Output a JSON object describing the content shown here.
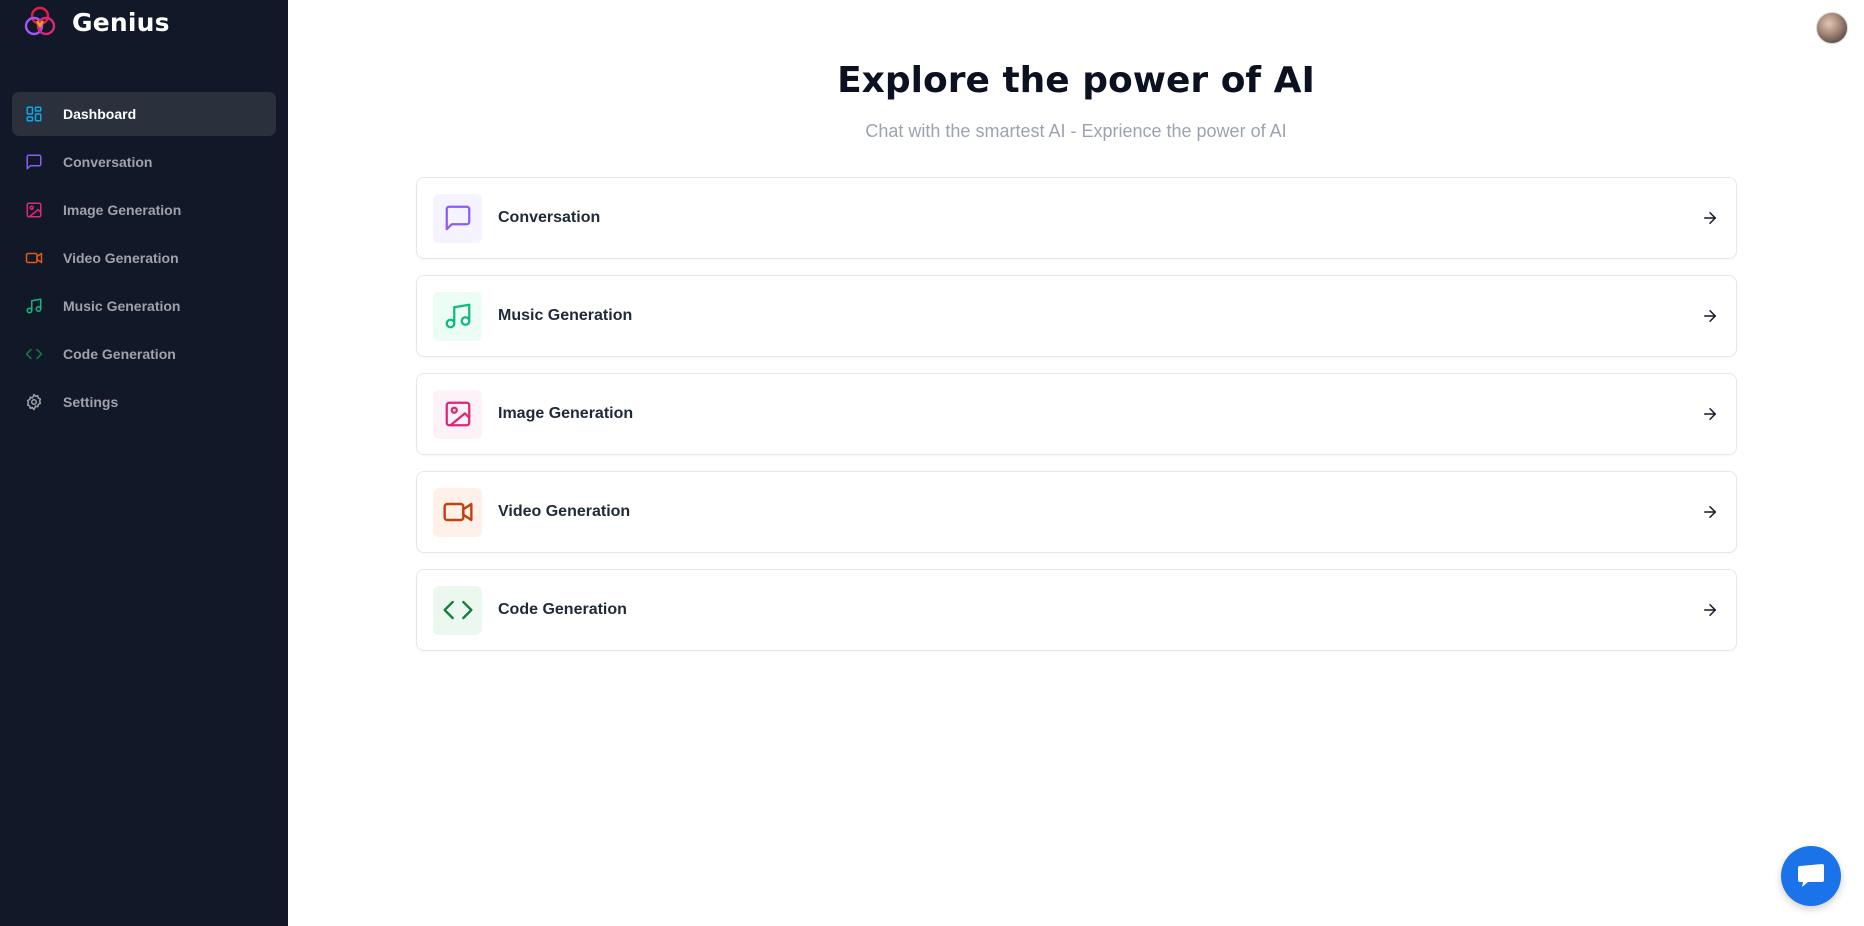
{
  "app": {
    "name": "Genius"
  },
  "sidebar": {
    "items": [
      {
        "label": "Dashboard",
        "icon": "dashboard-icon",
        "color": "#0ea5e9",
        "active": true
      },
      {
        "label": "Conversation",
        "icon": "message-square-icon",
        "color": "#8b5cf6"
      },
      {
        "label": "Image Generation",
        "icon": "image-icon",
        "color": "#db2777"
      },
      {
        "label": "Video Generation",
        "icon": "video-icon",
        "color": "#ea580c"
      },
      {
        "label": "Music Generation",
        "icon": "music-icon",
        "color": "#10b981"
      },
      {
        "label": "Code Generation",
        "icon": "code-icon",
        "color": "#15803d"
      },
      {
        "label": "Settings",
        "icon": "gear-icon",
        "color": "#a1a1aa"
      }
    ]
  },
  "main": {
    "title": "Explore the power of AI",
    "subtitle": "Chat with the smartest AI - Exprience the power of AI",
    "tools": [
      {
        "label": "Conversation",
        "icon": "message-square-icon",
        "color": "#8b5cf6",
        "bg": "#f5f3ff"
      },
      {
        "label": "Music Generation",
        "icon": "music-icon",
        "color": "#10b981",
        "bg": "#ecfdf5"
      },
      {
        "label": "Image Generation",
        "icon": "image-icon",
        "color": "#db2777",
        "bg": "#fdf2f8"
      },
      {
        "label": "Video Generation",
        "icon": "video-icon",
        "color": "#c2410c",
        "bg": "#fff7ed"
      },
      {
        "label": "Code Generation",
        "icon": "code-icon",
        "color": "#15803d",
        "bg": "#ecfdf3"
      }
    ]
  },
  "user": {
    "avatar": "avatar"
  },
  "support": {
    "icon": "chat-bubble-icon",
    "color": "#1a73e8"
  }
}
